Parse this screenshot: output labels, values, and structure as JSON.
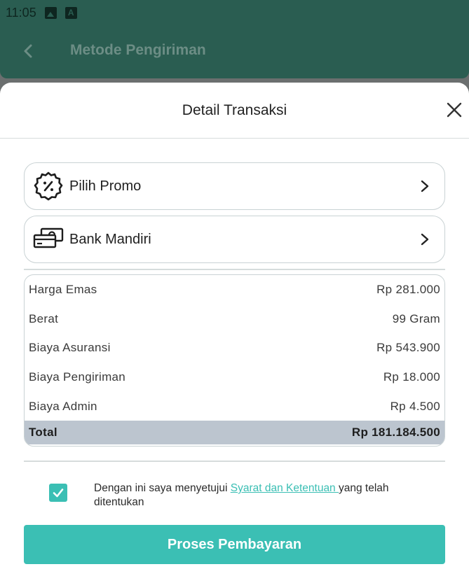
{
  "status_bar": {
    "time": "11:05",
    "icons": [
      "image-icon",
      "a-icon"
    ]
  },
  "app_bar": {
    "title": "Metode Pengiriman",
    "back_icon": "chevron-left-icon"
  },
  "sheet": {
    "title": "Detail Transaksi",
    "close_icon": "close-icon",
    "options": [
      {
        "label": "Pilih Promo",
        "icon": "promo-badge-icon"
      },
      {
        "label": "Bank Mandiri",
        "icon": "cash-icon"
      }
    ],
    "details": [
      {
        "label": "Harga Emas",
        "value": "Rp 281.000"
      },
      {
        "label": "Berat",
        "value": "99 Gram"
      },
      {
        "label": "Biaya Asuransi",
        "value": "Rp 543.900"
      },
      {
        "label": "Biaya Pengiriman",
        "value": "Rp 18.000"
      },
      {
        "label": "Biaya Admin",
        "value": "Rp 4.500"
      }
    ],
    "total": {
      "label": "Total",
      "value": "Rp 181.184.500"
    },
    "agreement": {
      "checked": true,
      "text_before": "Dengan ini saya menyetujui ",
      "link_text": "Syarat dan Ketentuan ",
      "text_after": "yang telah ditentukan"
    },
    "pay_button": "Proses Pembayaran"
  },
  "colors": {
    "accent": "#3bbfb4",
    "app_bar_dimmed": "#2a5d51",
    "overlay": "#6b6f6f",
    "total_row": "#bcc5cf"
  }
}
